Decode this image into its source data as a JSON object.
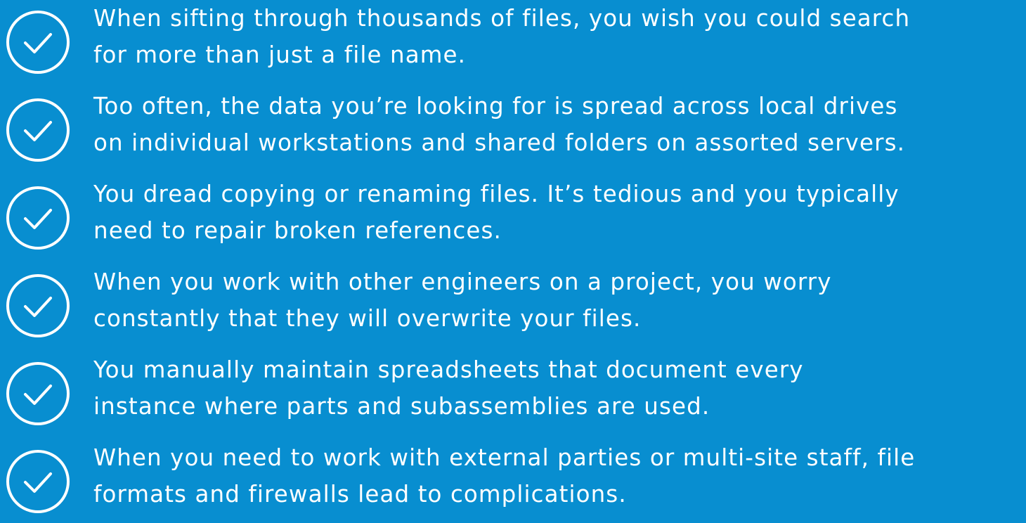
{
  "items": [
    {
      "icon": "check-circle-icon",
      "line1": "When sifting through thousands of files, you wish you could search",
      "line2": "for more than just a file name."
    },
    {
      "icon": "check-circle-icon",
      "line1": "Too often, the data you’re looking for is spread across local drives",
      "line2": "on individual workstations and shared folders on assorted servers."
    },
    {
      "icon": "check-circle-icon",
      "line1": "You dread copying or renaming files. It’s tedious and you typically",
      "line2": "need to repair broken references."
    },
    {
      "icon": "check-circle-icon",
      "line1": "When you work with other engineers on a project, you worry",
      "line2": "constantly that they will overwrite your files."
    },
    {
      "icon": "check-circle-icon",
      "line1": "You manually maintain spreadsheets that document every",
      "line2": "instance where parts and subassemblies are used."
    },
    {
      "icon": "check-circle-icon",
      "line1": "When you need to work with external parties or multi-site staff, file",
      "line2": "formats and firewalls lead to complications."
    }
  ],
  "colors": {
    "background": "#088ed0",
    "foreground": "#ffffff"
  }
}
